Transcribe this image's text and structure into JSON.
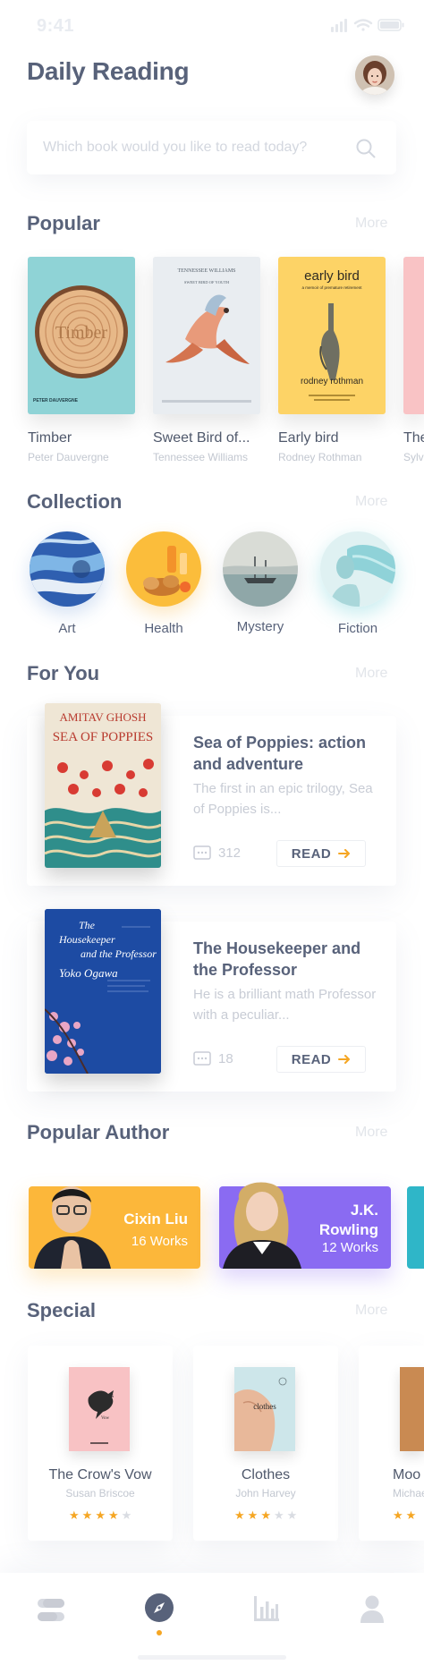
{
  "status": {
    "time": "9:41"
  },
  "header": {
    "title": "Daily Reading"
  },
  "search": {
    "placeholder": "Which book would you like to read today?"
  },
  "popular": {
    "title": "Popular",
    "more": "More",
    "books": [
      {
        "title": "Timber",
        "author": "Peter Dauvergne",
        "cover_text": "Timber",
        "cover_author": "PETER DAUVERGNE",
        "color": "#8fd3d6"
      },
      {
        "title": "Sweet Bird of...",
        "author": "Tennessee Williams",
        "cover_text": "TENNESSEE WILLIAMS",
        "cover_sub": "SWEET BIRD OF YOUTH",
        "color": "#e6eaef"
      },
      {
        "title": "Early bird",
        "author": "Rodney Rothman",
        "cover_text": "early bird",
        "cover_sub": "a memoir of premature retirement",
        "cover_author": "rodney rothman",
        "color": "#fdd366"
      },
      {
        "title": "The",
        "author": "Sylvi",
        "color": "#f9c3c5"
      }
    ]
  },
  "collection": {
    "title": "Collection",
    "more": "More",
    "items": [
      {
        "label": "Art"
      },
      {
        "label": "Health"
      },
      {
        "label": "Mystery"
      },
      {
        "label": "Fiction"
      }
    ]
  },
  "for_you": {
    "title": "For You",
    "more": "More",
    "items": [
      {
        "title": "Sea of Poppies: action and adventure",
        "desc": "The first in an epic trilogy, Sea of Poppies is...",
        "count": "312",
        "button": "READ",
        "cover_author": "AMITAV GHOSH",
        "cover_title": "SEA OF POPPIES"
      },
      {
        "title": "The Housekeeper and the Professor",
        "desc": "He is a brilliant math Professor with a peculiar...",
        "count": "18",
        "button": "READ",
        "cover_title": "The Housekeeper and the Professor",
        "cover_author": "Yoko Ogawa"
      }
    ]
  },
  "authors": {
    "title": "Popular Author",
    "more": "More",
    "items": [
      {
        "name": "Cixin Liu",
        "works": "16 Works",
        "color": "#fcb73a"
      },
      {
        "name": "J.K. Rowling",
        "works": "12 Works",
        "color": "#8a6bf2"
      }
    ]
  },
  "special": {
    "title": "Special",
    "more": "More",
    "items": [
      {
        "title": "The Crow's Vow",
        "author": "Susan Briscoe",
        "rating": 4,
        "cover_text": "The Crow's Vow"
      },
      {
        "title": "Clothes",
        "author": "John Harvey",
        "rating": 3,
        "cover_text": "clothes"
      },
      {
        "title": "Moo",
        "author": "Michae",
        "rating": 2
      }
    ]
  },
  "tabbar": {
    "items": [
      "library-icon",
      "compass-icon",
      "stats-icon",
      "profile-icon"
    ],
    "active": 1,
    "accent": "#f5a623"
  }
}
